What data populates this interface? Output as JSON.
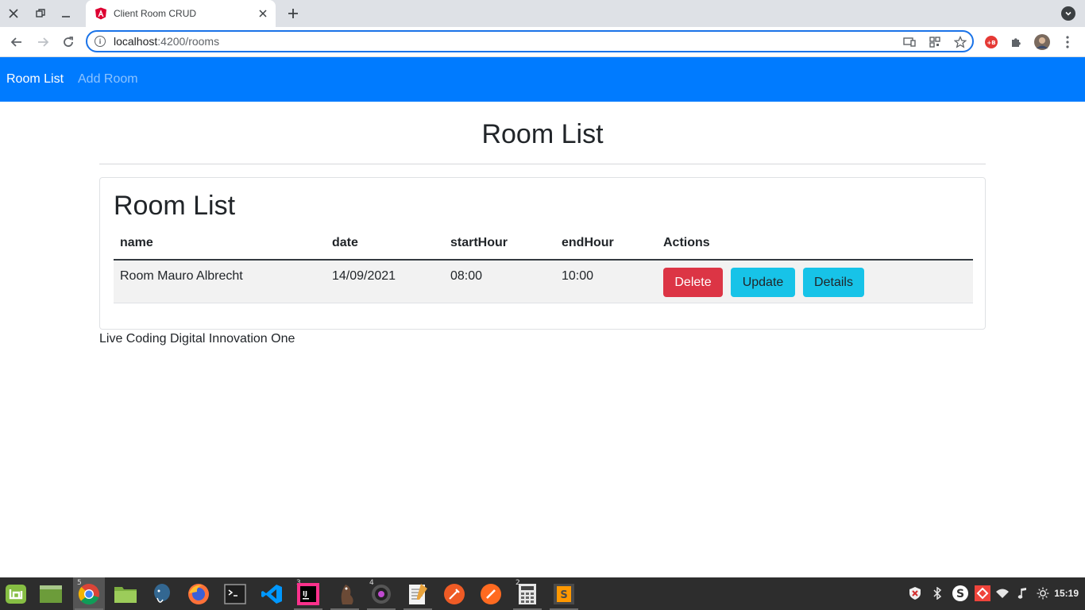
{
  "browser": {
    "tab_title": "Client Room CRUD",
    "url_host": "localhost",
    "url_path": ":4200/rooms"
  },
  "navbar": {
    "links": [
      {
        "label": "Room List",
        "active": true
      },
      {
        "label": "Add Room",
        "active": false
      }
    ],
    "color": "#007bff"
  },
  "page": {
    "heading": "Room List",
    "card_title": "Room List",
    "table": {
      "headers": [
        "name",
        "date",
        "startHour",
        "endHour",
        "Actions"
      ],
      "rows": [
        {
          "name": "Room Mauro Albrecht",
          "date": "14/09/2021",
          "startHour": "08:00",
          "endHour": "10:00",
          "actions": [
            "Delete",
            "Update",
            "Details"
          ]
        }
      ]
    },
    "footer": "Live Coding Digital Innovation One"
  },
  "colors": {
    "danger": "#dc3545",
    "info": "#17c3e8"
  },
  "taskbar": {
    "badges": {
      "chrome": "5",
      "intellij": "3",
      "camera": "4",
      "calculator": "2"
    },
    "clock": "15:19"
  }
}
